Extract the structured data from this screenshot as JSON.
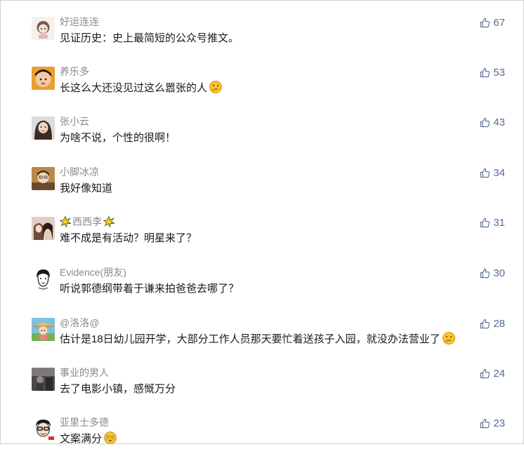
{
  "comments": [
    {
      "name": "好运连连",
      "text": "见证历史：史上最简短的公众号推文。",
      "likes": "67",
      "avatar": "avatar-cartoon-girl",
      "emoji": ""
    },
    {
      "name": "养乐多",
      "text": "长这么大还没见过这么嚣张的人",
      "likes": "53",
      "avatar": "avatar-child",
      "emoji": "thinking-face-emoji"
    },
    {
      "name": "张小云",
      "text": "为啥不说，个性的很啊！",
      "likes": "43",
      "avatar": "avatar-woman",
      "emoji": ""
    },
    {
      "name": "小脚冰凉",
      "text": "我好像知道",
      "likes": "34",
      "avatar": "avatar-anime",
      "emoji": ""
    },
    {
      "name": "西西李",
      "text": "难不成是有活动？明星来了？",
      "likes": "31",
      "avatar": "avatar-couple",
      "emoji": "",
      "stars": true
    },
    {
      "name": "Evidence(朋友)",
      "text": "听说郭德纲带着于谦来拍爸爸去哪了？",
      "likes": "30",
      "avatar": "avatar-sketch-face",
      "emoji": ""
    },
    {
      "name": "@洛洛@",
      "text": "估计是18日幼儿园开学，大部分工作人员那天要忙着送孩子入园，就没办法营业了",
      "likes": "28",
      "avatar": "avatar-cartoon-hat",
      "emoji": "thinking-face-emoji"
    },
    {
      "name": "事业的男人",
      "text": "去了电影小镇，感慨万分",
      "likes": "24",
      "avatar": "avatar-dark-room",
      "emoji": ""
    },
    {
      "name": "亚里士多德",
      "text": "文案满分",
      "likes": "23",
      "avatar": "avatar-glasses",
      "emoji": "flushed-face-emoji"
    }
  ],
  "colors": {
    "name": "#8a8a8a",
    "text": "#1a1a1a",
    "like": "#576b95"
  }
}
